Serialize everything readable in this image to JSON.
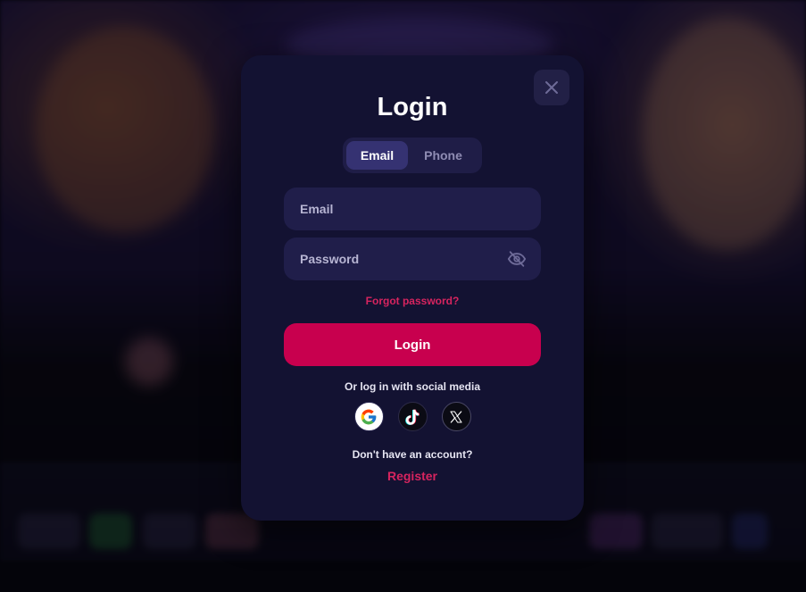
{
  "modal": {
    "title": "Login",
    "tabs": [
      {
        "label": "Email",
        "active": true
      },
      {
        "label": "Phone",
        "active": false
      }
    ],
    "email_field": {
      "placeholder": "Email",
      "value": ""
    },
    "password_field": {
      "placeholder": "Password",
      "value": ""
    },
    "forgot_password": "Forgot password?",
    "login_button": "Login",
    "social_caption": "Or log in with social media",
    "social_providers": [
      "google-icon",
      "tiktok-icon",
      "x-icon"
    ],
    "no_account_text": "Don't have an account?",
    "register_link": "Register"
  },
  "colors": {
    "modal_background": "#131232",
    "field_background": "#201e4a",
    "accent": "#c8004e",
    "link": "#d7245f"
  }
}
